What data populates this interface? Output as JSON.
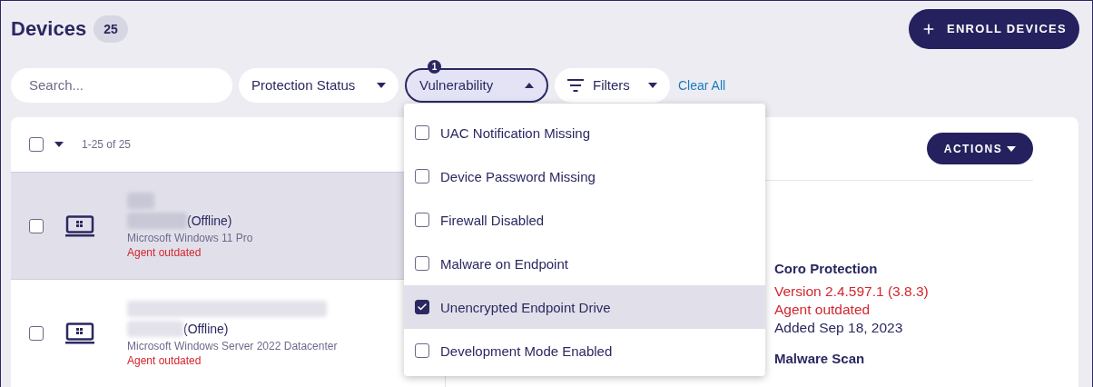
{
  "header": {
    "title": "Devices",
    "count": "25",
    "enroll_button": "ENROLL DEVICES"
  },
  "filter_bar": {
    "search": {
      "placeholder": "Search..."
    },
    "chips": [
      {
        "kind": "dropdown",
        "label": "Protection Status",
        "expanded": false
      },
      {
        "kind": "dropdown",
        "label": "Vulnerability",
        "expanded": true,
        "badge": "1"
      },
      {
        "kind": "filters",
        "label": "Filters",
        "expanded": false
      }
    ],
    "clear_link": "Clear All"
  },
  "list": {
    "header": {
      "checked": false,
      "range": "1-25 of 25"
    },
    "devices": [
      {
        "selected": true,
        "checked": false,
        "status": "(Offline)",
        "os": "Microsoft Windows 11 Pro",
        "agent": "Agent outdated"
      },
      {
        "selected": false,
        "checked": false,
        "status": "(Offline)",
        "os": "Microsoft Windows Server 2022 Datacenter",
        "agent": "Agent outdated"
      }
    ]
  },
  "detail": {
    "actions_button": "ACTIONS",
    "sections": [
      {
        "title": "Coro Protection",
        "lines": [
          {
            "kind": "alert",
            "text": "Version 2.4.597.1 (3.8.3)"
          },
          {
            "kind": "alert",
            "text": "Agent outdated"
          },
          {
            "kind": "normal",
            "text": "Added Sep 18, 2023"
          }
        ]
      },
      {
        "title": "Malware Scan"
      }
    ]
  },
  "vulnerability_menu": {
    "options": [
      {
        "label": "UAC Notification Missing",
        "checked": false
      },
      {
        "label": "Device Password Missing",
        "checked": false
      },
      {
        "label": "Firewall Disabled",
        "checked": false
      },
      {
        "label": "Malware on Endpoint",
        "checked": false
      },
      {
        "label": "Unencrypted Endpoint Drive",
        "checked": true
      },
      {
        "label": "Development Mode Enabled",
        "checked": false
      }
    ]
  }
}
